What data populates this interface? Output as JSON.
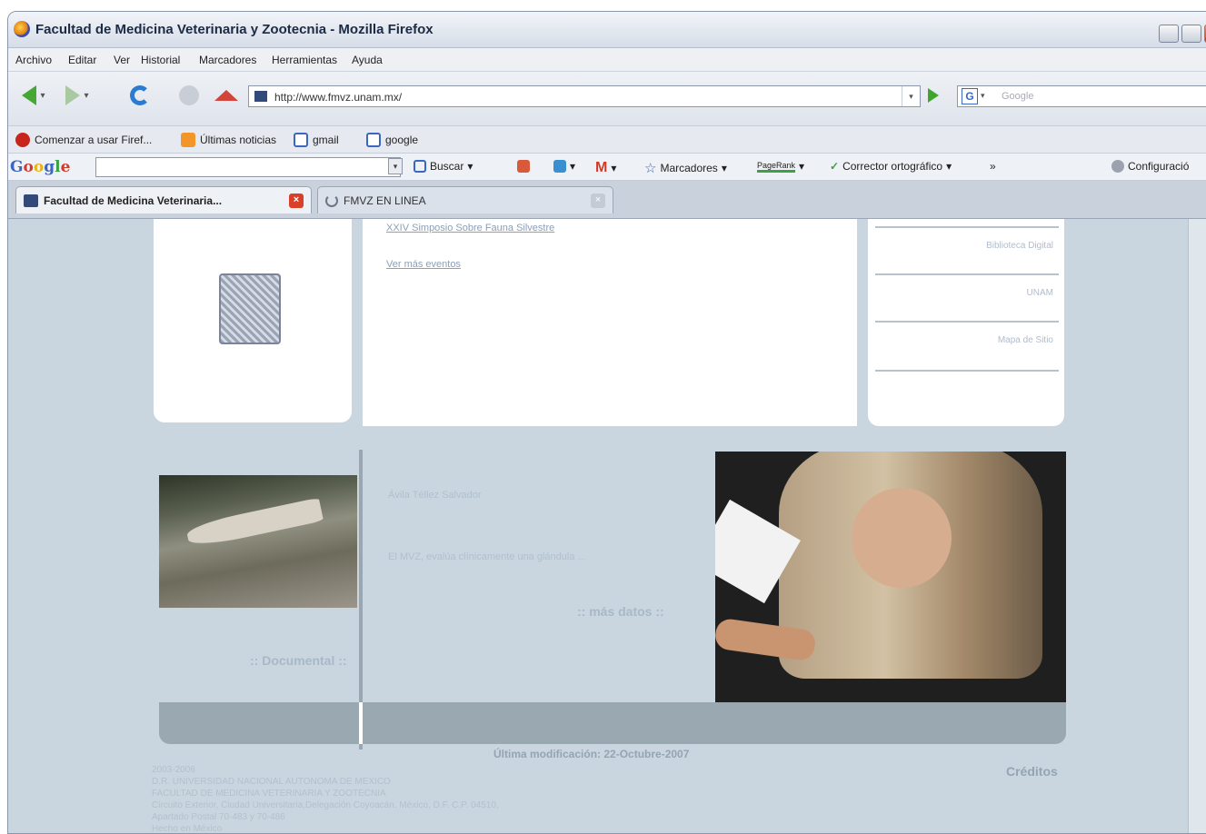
{
  "window": {
    "title": "Facultad de Medicina Veterinaria y Zootecnia - Mozilla Firefox"
  },
  "menu": [
    "Archivo",
    "Editar",
    "Ver",
    "Historial",
    "Marcadores",
    "Herramientas",
    "Ayuda"
  ],
  "nav": {
    "url": "http://www.fmvz.unam.mx/",
    "search_placeholder": "Google"
  },
  "bookmarks": [
    "Comenzar a usar Firef...",
    "Últimas noticias",
    "gmail",
    "google"
  ],
  "google_toolbar": {
    "logo": "Google",
    "buscar": "Buscar",
    "marcadores": "Marcadores",
    "pagerank": "PageRank",
    "corrector": "Corrector ortográfico",
    "more": "»",
    "config": "Configuració"
  },
  "tabs": [
    {
      "label": "Facultad de Medicina Veterinaria..."
    },
    {
      "label": "FMVZ EN LINEA"
    }
  ],
  "page": {
    "event_link": "XXIV Simposio Sobre Fauna Silvestre",
    "more_events": "Ver más eventos",
    "right_links": [
      "Biblioteca Digital",
      "UNAM",
      "Mapa de Sitio"
    ],
    "documental": ":: Documental ::",
    "author": "Ávila Téllez Salvador",
    "caption": "El MVZ, evalúa clínicamente una glándula ...",
    "mas_datos": ":: más datos ::",
    "last_modified": "Última modificación: 22-Octubre-2007",
    "creditos": "Créditos",
    "footer_lines": [
      "2003-2006",
      "D.R. UNIVERSIDAD NACIONAL AUTONOMA DE MEXICO",
      "FACULTAD DE MEDICINA VETERINARIA Y ZOOTECNIA",
      "Circuito Exterior, Ciudad Universitaria,Delegación Coyoacán, México, D.F. C.P. 04510,",
      "Apartado Postal 70-483 y 70-486",
      "Hecho en México"
    ]
  }
}
